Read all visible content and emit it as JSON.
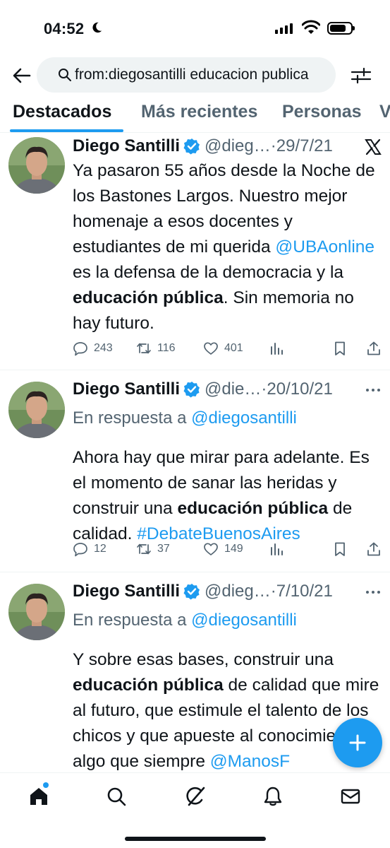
{
  "status_bar": {
    "time": "04:52"
  },
  "header": {
    "search_query": "from:diegosantilli educacion publica"
  },
  "tabs": [
    {
      "label": "Destacados",
      "active": true
    },
    {
      "label": "Más recientes",
      "active": false
    },
    {
      "label": "Personas",
      "active": false
    },
    {
      "label": "V",
      "active": false
    }
  ],
  "tweets": [
    {
      "name": "Diego Santilli",
      "handle": "@dieg…",
      "date": "·29/7/21",
      "menu_icon": "x-logo-icon",
      "text_parts": [
        "Ya pasaron 55 años desde la Noche de los Bastones Largos. Nuestro mejor homenaje a esos docentes y estudiantes de mi querida ",
        "@UBAonline",
        " es la defensa de la democracia y la ",
        "educación pública",
        ". Sin memoria no hay futuro."
      ],
      "replies": "243",
      "retweets": "116",
      "likes": "401"
    },
    {
      "name": "Diego Santilli",
      "handle": "@die…",
      "date": "·20/10/21",
      "menu_icon": "more-icon",
      "reply_prefix": "En respuesta a ",
      "reply_to": "@diegosantilli",
      "text_parts": [
        "Ahora hay que mirar para adelante. Es el momento de sanar las heridas y construir una ",
        "educación pública",
        " de calidad. ",
        "#DebateBuenosAires"
      ],
      "replies": "12",
      "retweets": "37",
      "likes": "149"
    },
    {
      "name": "Diego Santilli",
      "handle": "@dieg…",
      "date": "·7/10/21",
      "menu_icon": "more-icon",
      "reply_prefix": "En respuesta a ",
      "reply_to": "@diegosantilli",
      "text_parts": [
        "Y sobre esas bases, construir una ",
        "educación pública",
        " de calidad que mire al futuro, que estimule el talento de los chicos y que apueste al conocimiento, algo que siempre ",
        "@ManosF"
      ]
    }
  ],
  "colors": {
    "accent": "#1d9bf0",
    "text": "#0f1419",
    "muted": "#536471",
    "search_bg": "#eff3f4"
  }
}
